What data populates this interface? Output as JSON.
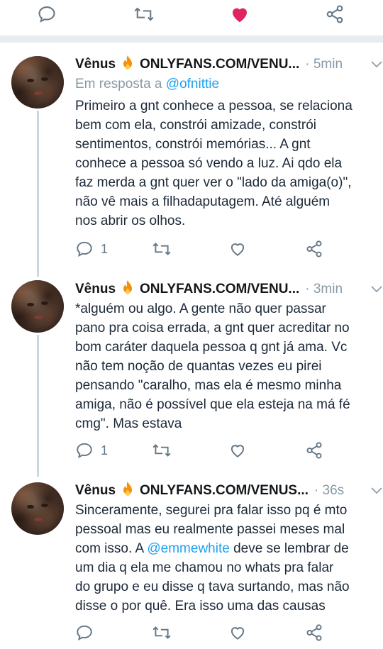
{
  "top_actions": {
    "reply_icon": "reply-icon",
    "retweet_icon": "retweet-icon",
    "like_icon": "heart-filled-icon",
    "share_icon": "share-icon",
    "like_color": "#e0245e"
  },
  "tweets": [
    {
      "name": "Vênus",
      "handle": "ONLYFANS.COM/VENU...",
      "time": "· 5min",
      "reply_prefix": "Em resposta a",
      "reply_mention": "@ofnittie",
      "lines": [
        "Primeiro a gnt conhece a pessoa, se relaciona",
        "bem com ela, constrói amizade, constrói",
        "sentimentos, constrói memórias... A gnt",
        "conhece  a pessoa só vendo a luz. Ai qdo ela",
        "faz merda a gnt quer ver o \"lado da amiga(o)\",",
        "não vê mais a filhadaputagem. Até alguém",
        "nos abrir os olhos."
      ],
      "reply_count": "1"
    },
    {
      "name": "Vênus",
      "handle": "ONLYFANS.COM/VENU...",
      "time": "· 3min",
      "lines": [
        "*alguém ou algo. A gente não quer passar",
        "pano pra  coisa errada, a gnt quer acreditar no",
        "bom caráter daquela pessoa q  gnt já ama. Vc",
        "não tem noção de quantas vezes eu pirei",
        "pensando \"caralho, mas ela é mesmo minha",
        "amiga, não é possível que ela esteja na má fé",
        "cmg\". Mas estava"
      ],
      "reply_count": "1"
    },
    {
      "name": "Vênus",
      "handle": "ONLYFANS.COM/VENUS...",
      "time": "· 36s",
      "lines_before_mention": [
        "Sinceramente, segurei pra falar isso pq é mto",
        "pessoal mas eu realmente passei meses mal"
      ],
      "mention_line_prefix": "com isso. A ",
      "mention": "@emmewhite",
      "mention_line_suffix": " deve se lembrar de",
      "lines_after_mention": [
        "um dia q ela me chamou no whats pra falar",
        "do grupo e eu disse q tava surtando, mas não",
        "disse o por quê. Era isso uma das causas"
      ],
      "reply_count": ""
    }
  ],
  "colors": {
    "accent": "#1da1f2",
    "muted": "#8899a6",
    "icon": "#657786",
    "divider": "#e6ecf0"
  }
}
